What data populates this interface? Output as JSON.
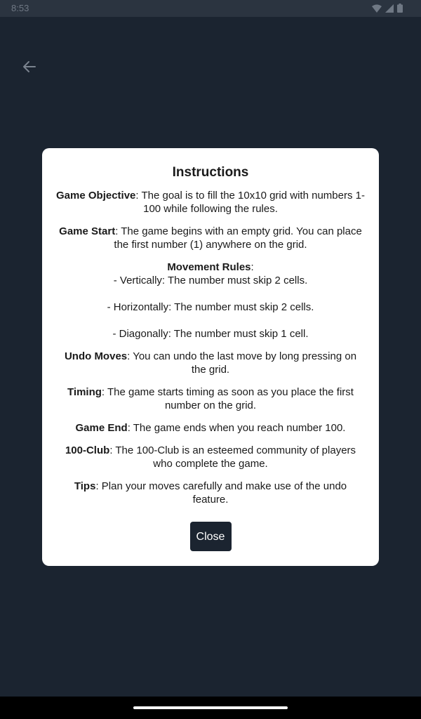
{
  "status_bar": {
    "time": "8:53",
    "icons": [
      "wifi-icon",
      "cellular-signal-icon",
      "battery-icon"
    ]
  },
  "header": {
    "back_icon": "arrow-left-icon"
  },
  "dialog": {
    "title": "Instructions",
    "sections": [
      {
        "heading": "Game Objective",
        "text": ": The goal is to fill the 10x10 grid with numbers 1-100 while following the rules."
      },
      {
        "heading": "Game Start",
        "text": ": The game begins with an empty grid. You can place the first number (1) anywhere on the grid."
      }
    ],
    "movement": {
      "heading": "Movement Rules",
      "suffix": ":",
      "rules": [
        "- Vertically: The number must skip 2 cells.",
        "- Horizontally: The number must skip 2 cells.",
        "- Diagonally: The number must skip 1 cell."
      ]
    },
    "sections_after": [
      {
        "heading": "Undo Moves",
        "text": ": You can undo the last move by long pressing on the grid."
      },
      {
        "heading": "Timing",
        "text": ": The game starts timing as soon as you place the first number on the grid."
      },
      {
        "heading": "Game End",
        "text": ": The game ends when you reach number 100."
      },
      {
        "heading": "100-Club",
        "text": ": The 100-Club is an esteemed community of players who complete the game."
      },
      {
        "heading": "Tips",
        "text": ": Plan your moves carefully and make use of the undo feature."
      }
    ],
    "close_label": "Close"
  },
  "colors": {
    "background": "#1b2430",
    "dialog": "#ffffff",
    "button": "#1b2430",
    "text": "#1a1a1a"
  }
}
